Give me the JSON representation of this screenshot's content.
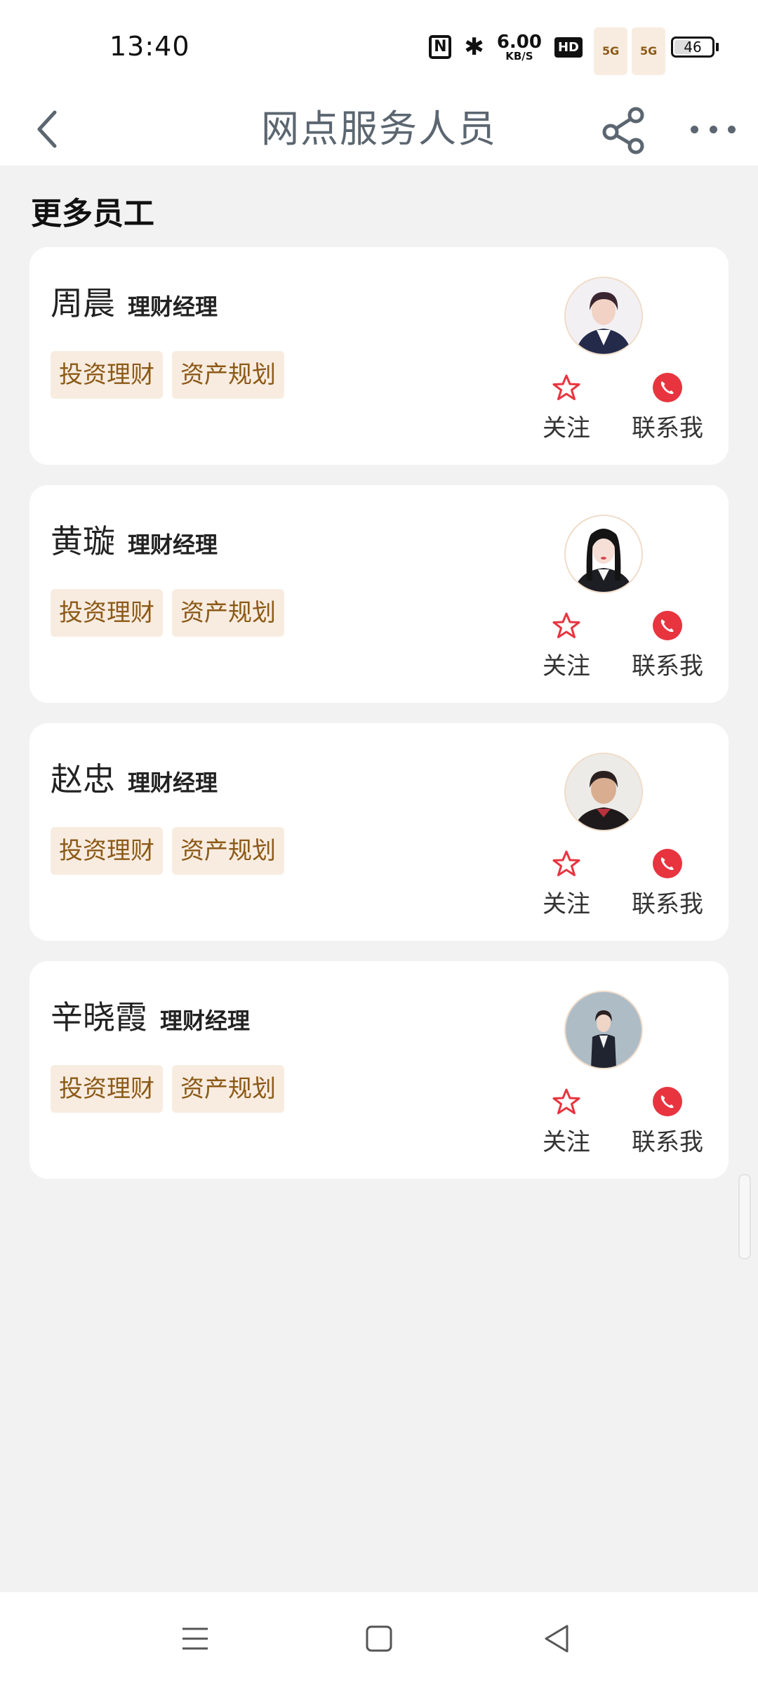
{
  "status_bar": {
    "time": "13:40",
    "speed_value": "6.00",
    "speed_unit": "KB/S",
    "hd_label": "HD",
    "signal1_label": "5G",
    "signal2_label": "5G",
    "battery": "46"
  },
  "nav": {
    "title": "网点服务人员"
  },
  "section_title": "更多员工",
  "employees": [
    {
      "name": "周晨",
      "role": "理财经理",
      "tags": [
        "投资理财",
        "资产规划"
      ],
      "follow_label": "关注",
      "contact_label": "联系我"
    },
    {
      "name": "黄璇",
      "role": "理财经理",
      "tags": [
        "投资理财",
        "资产规划"
      ],
      "follow_label": "关注",
      "contact_label": "联系我"
    },
    {
      "name": "赵忠",
      "role": "理财经理",
      "tags": [
        "投资理财",
        "资产规划"
      ],
      "follow_label": "关注",
      "contact_label": "联系我"
    },
    {
      "name": "辛晓霞",
      "role": "理财经理",
      "tags": [
        "投资理财",
        "资产规划"
      ],
      "follow_label": "关注",
      "contact_label": "联系我"
    }
  ],
  "colors": {
    "accent_red": "#e8343f",
    "tag_bg": "#f8ece1",
    "tag_text": "#8c5a16"
  }
}
